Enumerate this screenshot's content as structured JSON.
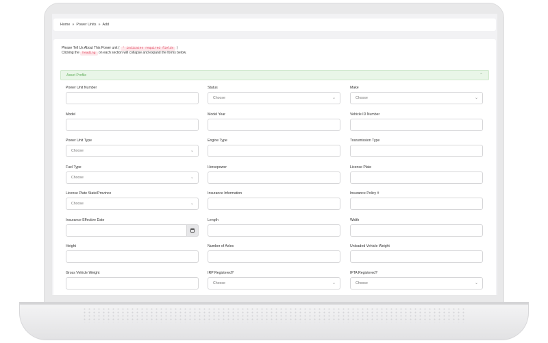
{
  "breadcrumb": {
    "home": "Home",
    "sep1": "»",
    "units": "Power Units",
    "sep2": "»",
    "add": "Add"
  },
  "intro": {
    "line1_before": "Please Tell Us About This Power unit (",
    "required_tag": "* indicates required fields",
    "line1_after": ")",
    "line2_before": "Clicking the",
    "heading_tag": "heading",
    "line2_after": "on each section will collapse and expand the forms below."
  },
  "section": {
    "title": "Asset Profile",
    "chevron": "chevron-up-icon"
  },
  "fields": [
    {
      "label": "Power Unit Number",
      "type": "text",
      "value": ""
    },
    {
      "label": "Status",
      "type": "select",
      "value": "Choose"
    },
    {
      "label": "Make",
      "type": "select",
      "value": "Choose"
    },
    {
      "label": "Model",
      "type": "text",
      "value": ""
    },
    {
      "label": "Model Year",
      "type": "text",
      "value": ""
    },
    {
      "label": "Vehicle ID Number",
      "type": "text",
      "value": ""
    },
    {
      "label": "Power Unit Type",
      "type": "select",
      "value": "Choose"
    },
    {
      "label": "Engine Type",
      "type": "text",
      "value": ""
    },
    {
      "label": "Transmission Type",
      "type": "text",
      "value": ""
    },
    {
      "label": "Fuel Type",
      "type": "select",
      "value": "Choose"
    },
    {
      "label": "Horsepower",
      "type": "text",
      "value": ""
    },
    {
      "label": "License Plate",
      "type": "text",
      "value": ""
    },
    {
      "label": "License Plate State/Province",
      "type": "select",
      "value": "Choose"
    },
    {
      "label": "Insurance Information",
      "type": "text",
      "value": ""
    },
    {
      "label": "Insurance Policy #",
      "type": "text",
      "value": ""
    },
    {
      "label": "Insurance Effective Date",
      "type": "date",
      "value": ""
    },
    {
      "label": "Length",
      "type": "text",
      "value": ""
    },
    {
      "label": "Width",
      "type": "text",
      "value": ""
    },
    {
      "label": "Height",
      "type": "text",
      "value": ""
    },
    {
      "label": "Number of Axles",
      "type": "text",
      "value": ""
    },
    {
      "label": "Unloaded Vehicle Weight",
      "type": "text",
      "value": ""
    },
    {
      "label": "Gross Vehicle Weight",
      "type": "text",
      "value": ""
    },
    {
      "label": "IRP Registered?",
      "type": "select",
      "value": "Choose"
    },
    {
      "label": "IFTA Registered?",
      "type": "select",
      "value": "Choose"
    }
  ],
  "colors": {
    "accent_green": "#5fae58",
    "section_bg": "#e9f6e8",
    "required_tag": "#e0405a"
  }
}
